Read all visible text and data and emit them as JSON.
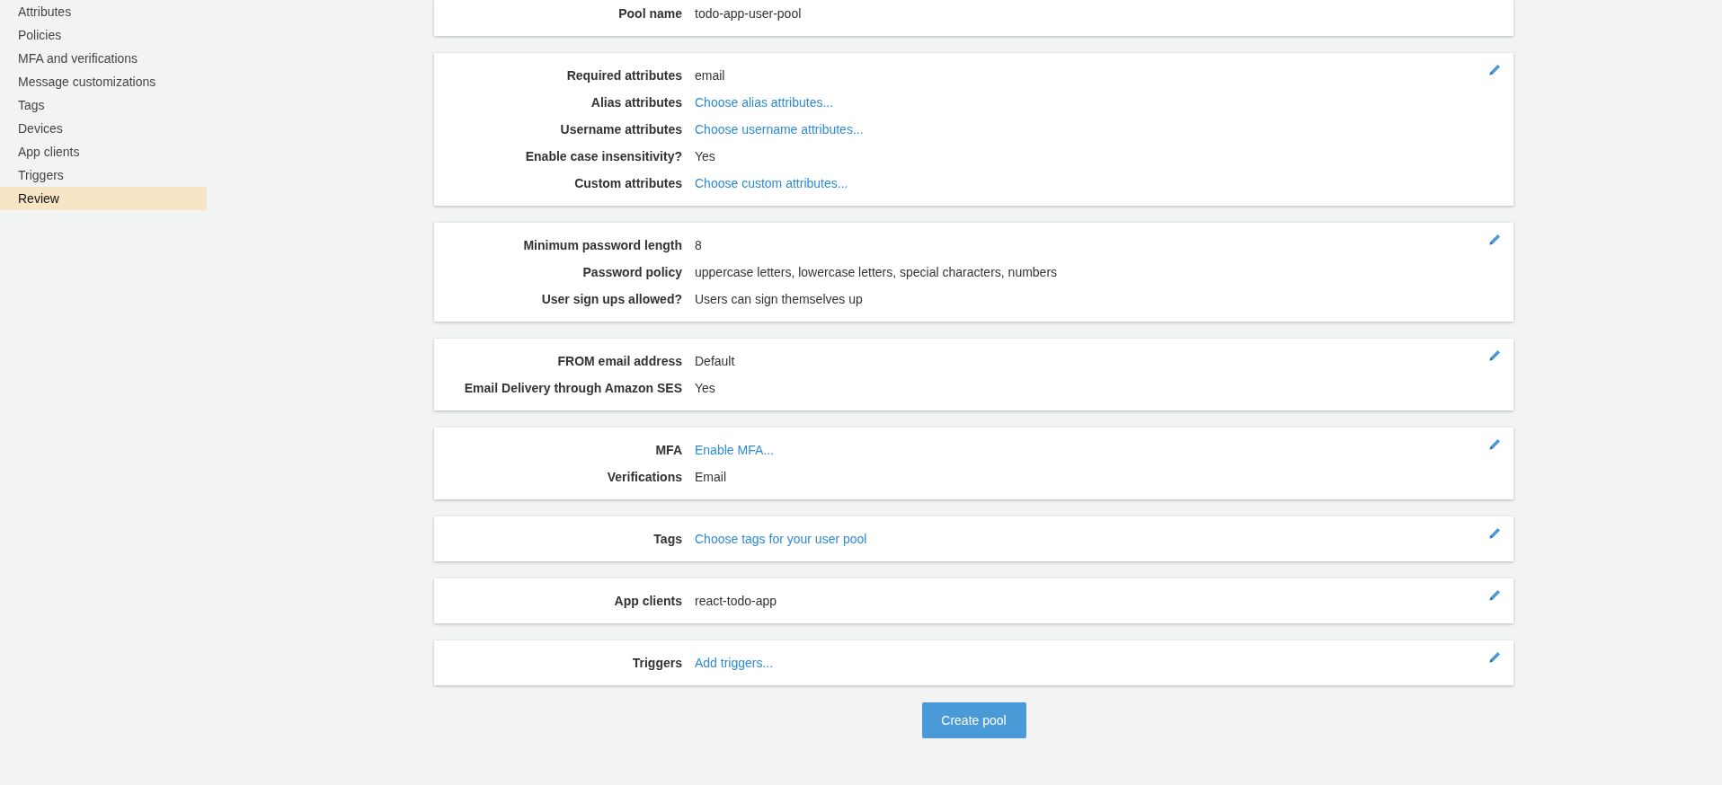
{
  "sidebar": {
    "items": [
      {
        "label": "Attributes",
        "selected": false
      },
      {
        "label": "Policies",
        "selected": false
      },
      {
        "label": "MFA and verifications",
        "selected": false
      },
      {
        "label": "Message customizations",
        "selected": false
      },
      {
        "label": "Tags",
        "selected": false
      },
      {
        "label": "Devices",
        "selected": false
      },
      {
        "label": "App clients",
        "selected": false
      },
      {
        "label": "Triggers",
        "selected": false
      },
      {
        "label": "Review",
        "selected": true
      }
    ]
  },
  "sections": [
    {
      "editable": false,
      "rows": [
        {
          "label": "Pool name",
          "value": "todo-app-user-pool",
          "kind": "text"
        }
      ]
    },
    {
      "editable": true,
      "rows": [
        {
          "label": "Required attributes",
          "value": "email",
          "kind": "text"
        },
        {
          "label": "Alias attributes",
          "value": "Choose alias attributes...",
          "kind": "link"
        },
        {
          "label": "Username attributes",
          "value": "Choose username attributes...",
          "kind": "link"
        },
        {
          "label": "Enable case insensitivity?",
          "value": "Yes",
          "kind": "text"
        },
        {
          "label": "Custom attributes",
          "value": "Choose custom attributes...",
          "kind": "link"
        }
      ]
    },
    {
      "editable": true,
      "rows": [
        {
          "label": "Minimum password length",
          "value": "8",
          "kind": "text"
        },
        {
          "label": "Password policy",
          "value": "uppercase letters, lowercase letters, special characters, numbers",
          "kind": "text"
        },
        {
          "label": "User sign ups allowed?",
          "value": "Users can sign themselves up",
          "kind": "text"
        }
      ]
    },
    {
      "editable": true,
      "rows": [
        {
          "label": "FROM email address",
          "value": "Default",
          "kind": "text"
        },
        {
          "label": "Email Delivery through Amazon SES",
          "value": "Yes",
          "kind": "text"
        }
      ]
    },
    {
      "editable": true,
      "rows": [
        {
          "label": "MFA",
          "value": "Enable MFA...",
          "kind": "link"
        },
        {
          "label": "Verifications",
          "value": "Email",
          "kind": "text"
        }
      ]
    },
    {
      "editable": true,
      "rows": [
        {
          "label": "Tags",
          "value": "Choose tags for your user pool",
          "kind": "link"
        }
      ]
    },
    {
      "editable": true,
      "rows": [
        {
          "label": "App clients",
          "value": "react-todo-app",
          "kind": "text"
        }
      ]
    },
    {
      "editable": true,
      "rows": [
        {
          "label": "Triggers",
          "value": "Add triggers...",
          "kind": "link"
        }
      ]
    }
  ],
  "create_button": "Create pool"
}
